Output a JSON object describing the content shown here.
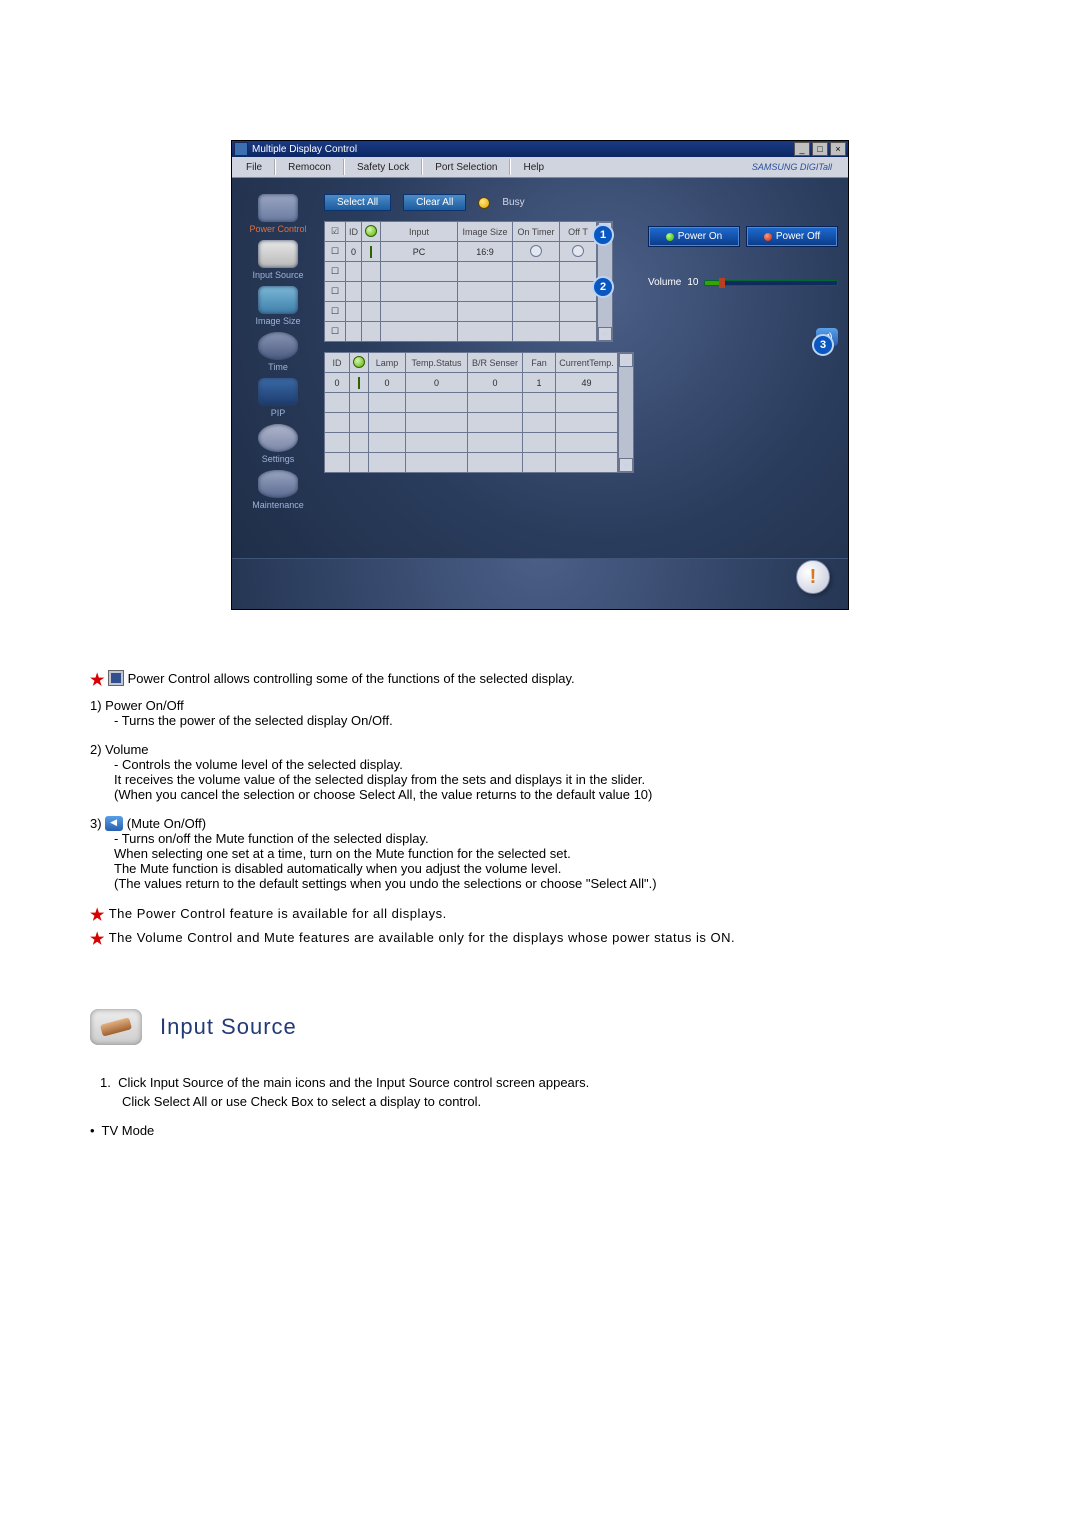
{
  "app": {
    "title": "Multiple Display Control",
    "menus": [
      "File",
      "Remocon",
      "Safety Lock",
      "Port Selection",
      "Help"
    ],
    "brand": "SAMSUNG DIGITall"
  },
  "sidebar": {
    "items": [
      {
        "label": "Power Control",
        "active": true
      },
      {
        "label": "Input Source"
      },
      {
        "label": "Image Size"
      },
      {
        "label": "Time"
      },
      {
        "label": "PIP"
      },
      {
        "label": "Settings"
      },
      {
        "label": "Maintenance"
      }
    ]
  },
  "toolbar": {
    "select_all": "Select All",
    "clear_all": "Clear All",
    "busy": "Busy"
  },
  "table1": {
    "headers": [
      "",
      "ID",
      "",
      "Input",
      "Image Size",
      "On Timer",
      "Off T"
    ],
    "rows": [
      {
        "checked": true,
        "id": "0",
        "status": "green",
        "input": "PC",
        "size": "16:9",
        "ontimer": "off",
        "offtimer": "off"
      },
      {
        "checked": false
      },
      {
        "checked": false
      },
      {
        "checked": false
      },
      {
        "checked": false
      }
    ]
  },
  "table2": {
    "headers": [
      "ID",
      "",
      "Lamp",
      "Temp.Status",
      "B/R Senser",
      "Fan",
      "CurrentTemp."
    ],
    "rows": [
      {
        "id": "0",
        "status": "green",
        "lamp": "0",
        "temp_st": "0",
        "br": "0",
        "fan": "1",
        "curtemp": "49"
      },
      {},
      {},
      {},
      {}
    ]
  },
  "power": {
    "on": "Power On",
    "off": "Power Off"
  },
  "volume": {
    "label": "Volume",
    "value": "10"
  },
  "callouts": {
    "c1": "1",
    "c2": "2",
    "c3": "3"
  },
  "doc": {
    "intro": "Power Control allows controlling some of the functions of the selected display.",
    "n1_title": "Power On/Off",
    "n1_a": "Turns the power of the selected display On/Off.",
    "n2_title": "Volume",
    "n2_a": "Controls the volume level of the selected display.",
    "n2_b": "It receives the volume value of the selected display from the sets and displays it in the slider.",
    "n2_c": "(When you cancel the selection or choose Select All, the value returns to the default value 10)",
    "n3_title": "(Mute On/Off)",
    "n3_a": "Turns on/off the Mute function of the selected display.",
    "n3_b": "When selecting one set at a time, turn on the Mute function for the selected set.",
    "n3_c": "The Mute function is disabled automatically when you adjust the volume level.",
    "n3_d": "(The values return to the default settings when you undo the selections or choose \"Select All\".)",
    "note1": "The Power Control feature is available for all displays.",
    "note2": "The Volume Control and Mute features are available only for the displays whose power status is ON.",
    "section2_title": "Input Source",
    "s2_1a": "Click Input Source of the main icons and the Input Source control screen appears.",
    "s2_1b": "Click Select All or use Check Box to select a display to control.",
    "s2_bullet": "TV Mode"
  }
}
